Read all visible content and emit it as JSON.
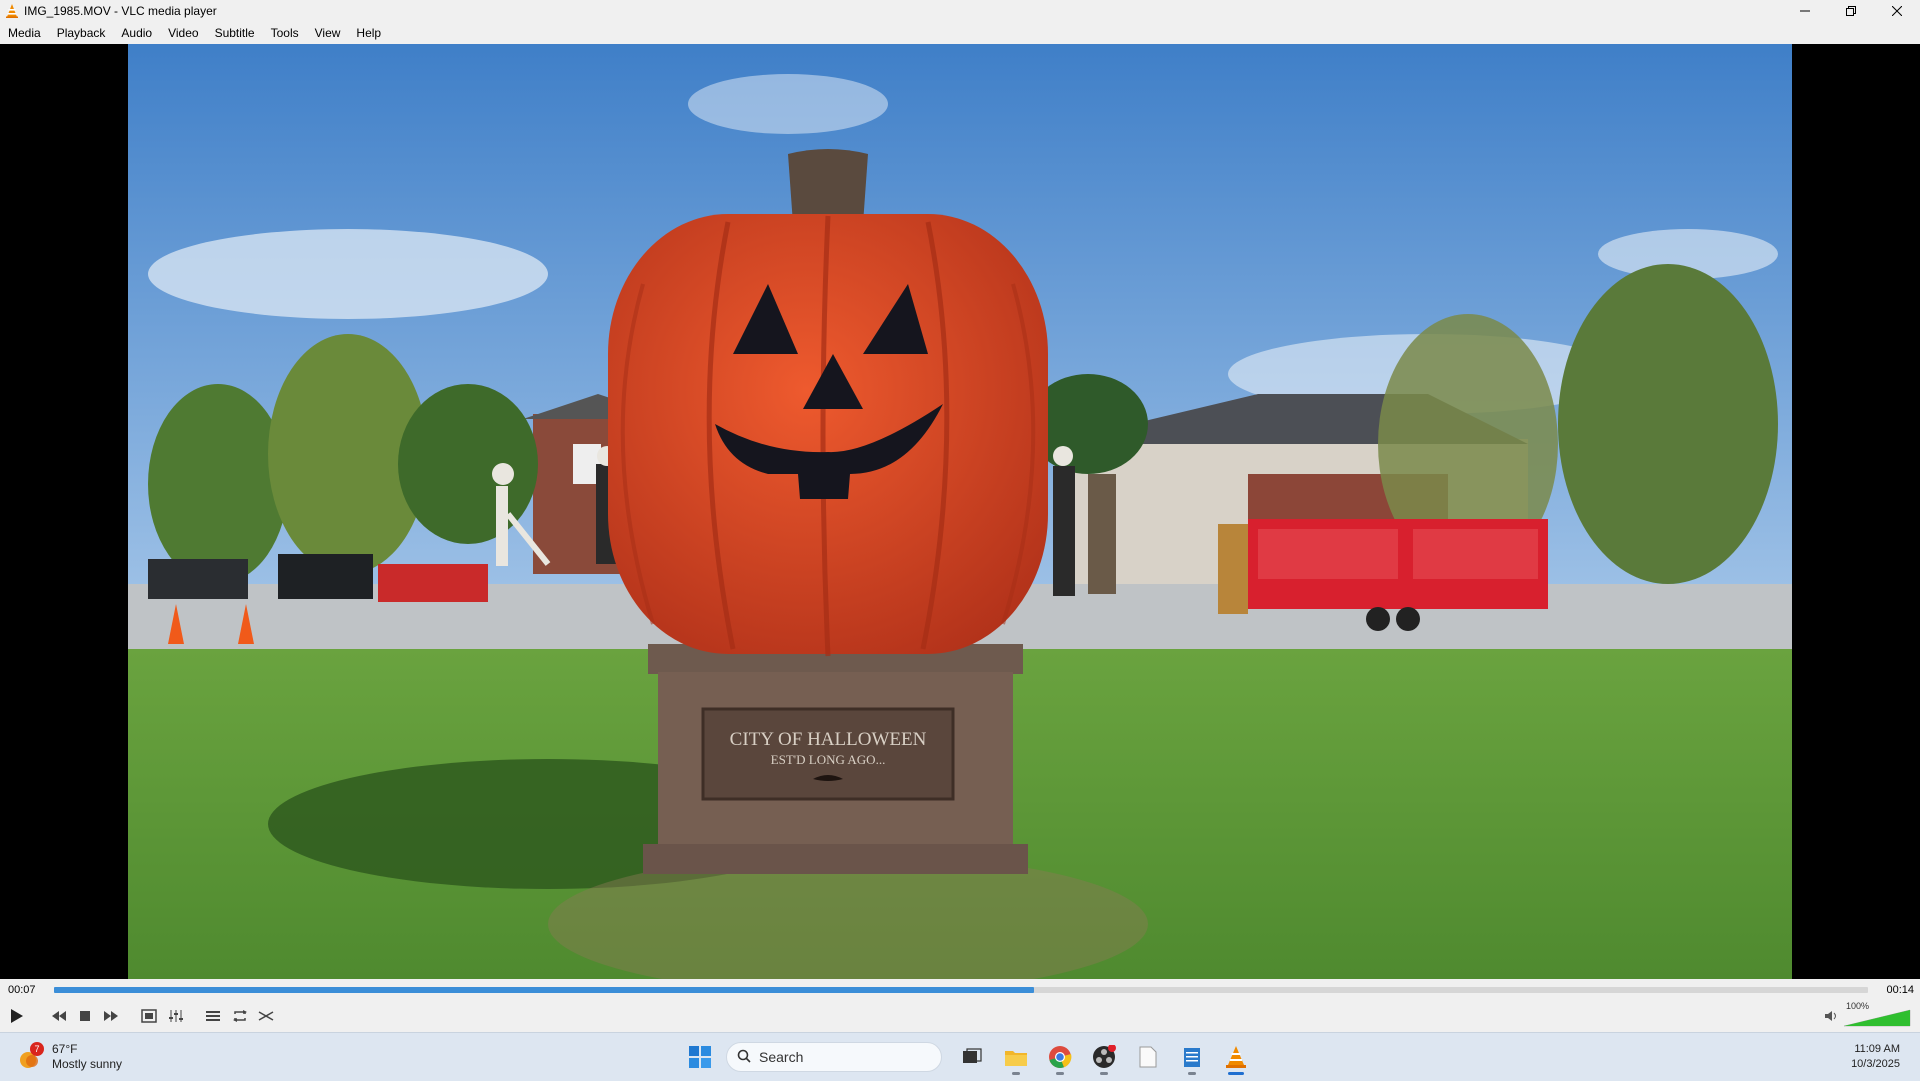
{
  "window": {
    "title": "IMG_1985.MOV - VLC media player"
  },
  "menu": [
    "Media",
    "Playback",
    "Audio",
    "Video",
    "Subtitle",
    "Tools",
    "View",
    "Help"
  ],
  "video": {
    "plaque_line1": "CITY OF HALLOWEEN",
    "plaque_line2": "EST'D LONG AGO..."
  },
  "player": {
    "time_elapsed": "00:07",
    "time_total": "00:14",
    "progress": 0.54,
    "volume_label": "100%",
    "volume": 1.0
  },
  "taskbar": {
    "weather_temp": "67°F",
    "weather_desc": "Mostly sunny",
    "weather_badge": "7",
    "search_placeholder": "Search",
    "time": "11:09 AM",
    "date": "10/3/2025"
  },
  "colors": {
    "seek_fill": "#3b8ed8",
    "volume_fill": "#2fbf2f",
    "pumpkin": "#d8401f",
    "sky": "#5f97d2",
    "grass": "#5f9a3a"
  }
}
